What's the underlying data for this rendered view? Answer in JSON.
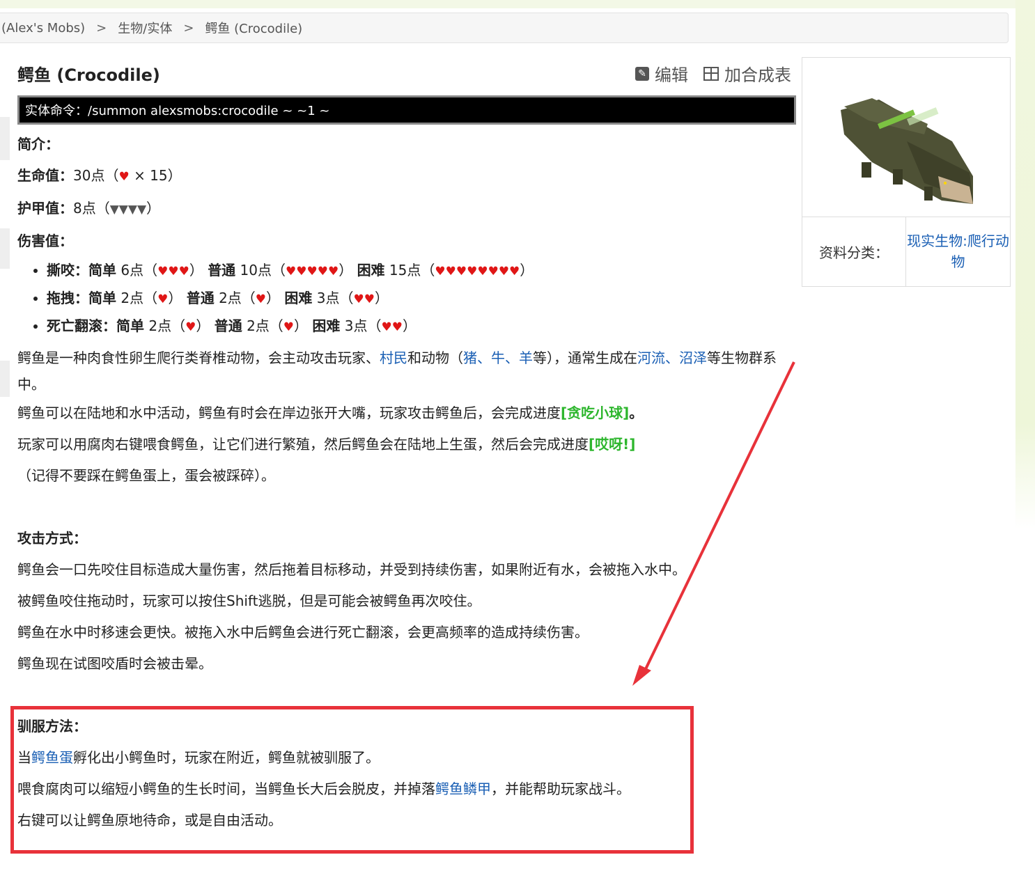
{
  "breadcrumb": [
    "(Alex's Mobs)",
    "生物/实体",
    "鳄鱼 (Crocodile)"
  ],
  "title": "鳄鱼 (Crocodile)",
  "actions": {
    "edit": "编辑",
    "add_table": "加合成表"
  },
  "command": "实体命令：/summon alexsmobs:crocodile ~ ~1 ~",
  "intro_label": "简介：",
  "hp": {
    "label": "生命值：",
    "value": "30点（",
    "mult": "× 15）"
  },
  "armor": {
    "label": "护甲值：",
    "value": "8点（",
    "end": "）"
  },
  "damage_label": "伤害值：",
  "damage": [
    {
      "name": "撕咬：",
      "easy": "简单",
      "easy_val": "6点（",
      "normal": "普通",
      "normal_val": "10点（",
      "hard": "困难",
      "hard_val": "15点（"
    },
    {
      "name": "拖拽：",
      "easy": "简单",
      "easy_val": "2点（",
      "normal": "普通",
      "normal_val": "2点（",
      "hard": "困难",
      "hard_val": "3点（"
    },
    {
      "name": "死亡翻滚：",
      "easy": "简单",
      "easy_val": "2点（",
      "normal": "普通",
      "normal_val": "2点（",
      "hard": "困难",
      "hard_val": "3点（"
    }
  ],
  "para1": {
    "a": "鳄鱼是一种肉食性卵生爬行类脊椎动物，会主动攻击玩家、",
    "villager": "村民",
    "b": "和动物（",
    "pig": "猪",
    "c1": "、",
    "cow": "牛",
    "c2": "、",
    "sheep": "羊",
    "d": "等），通常生成在",
    "river": "河流",
    "c3": "、",
    "swamp": "沼泽",
    "e": "等生物群系中。"
  },
  "para2": {
    "a": "鳄鱼可以在陆地和水中活动，鳄鱼有时会在岸边张开大嘴，玩家攻击鳄鱼后，会完成进度",
    "adv": "[贪吃小球]",
    "b": "。"
  },
  "para3": {
    "a": "玩家可以用腐肉右键喂食鳄鱼，让它们进行繁殖，然后鳄鱼会在陆地上生蛋，然后会完成进度",
    "adv": "[哎呀!]"
  },
  "para4": "（记得不要踩在鳄鱼蛋上，蛋会被踩碎）。",
  "attack_label": "攻击方式：",
  "attack": [
    "鳄鱼会一口先咬住目标造成大量伤害，然后拖着目标移动，并受到持续伤害，如果附近有水，会被拖入水中。",
    "被鳄鱼咬住拖动时，玩家可以按住Shift逃脱，但是可能会被鳄鱼再次咬住。",
    "鳄鱼在水中时移速会更快。被拖入水中后鳄鱼会进行死亡翻滚，会更高频率的造成持续伤害。",
    "鳄鱼现在试图咬盾时会被击晕。"
  ],
  "tame_label": "驯服方法：",
  "tame1": {
    "a": "当",
    "egg": "鳄鱼蛋",
    "b": "孵化出小鳄鱼时，玩家在附近，鳄鱼就被驯服了。"
  },
  "tame2": {
    "a": "喂食腐肉可以缩短小鳄鱼的生长时间，当鳄鱼长大后会脱皮，并掉落",
    "scute": "鳄鱼鳞甲",
    "b": "，并能帮助玩家战斗。"
  },
  "tame3": "右键可以让鳄鱼原地待命，或是自由活动。",
  "infobox": {
    "label": "资料分类：",
    "value": "现实生物:爬行动物"
  },
  "colors": {
    "link": "#1a5fb4",
    "advancement": "#2db62d",
    "highlight": "#e8323a",
    "heart": "#e01616"
  }
}
